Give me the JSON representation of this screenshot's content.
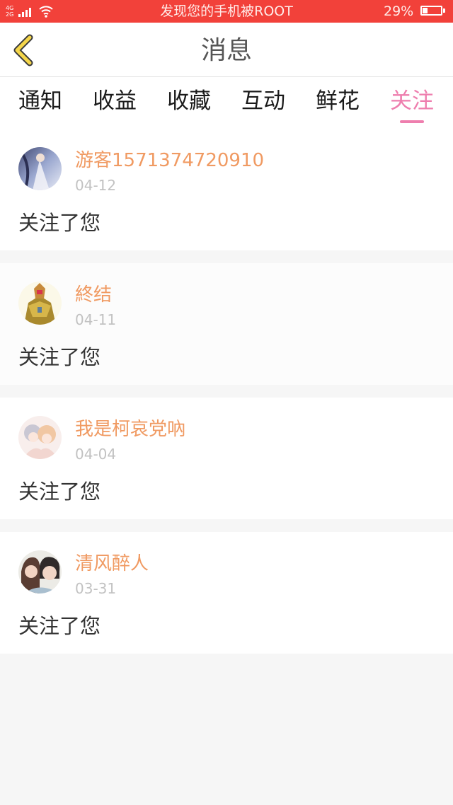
{
  "status_bar": {
    "network_top": "4G",
    "network_bottom": "2G",
    "title": "发现您的手机被ROOT",
    "battery": "29%",
    "battery_level": 0.29,
    "accent": "#f2413a"
  },
  "header": {
    "title": "消息",
    "back_icon": "chevron-left-icon",
    "back_icon_color": "#f5d64a"
  },
  "tabs": [
    {
      "label": "通知",
      "active": false
    },
    {
      "label": "收益",
      "active": false
    },
    {
      "label": "收藏",
      "active": false
    },
    {
      "label": "互动",
      "active": false
    },
    {
      "label": "鲜花",
      "active": false
    },
    {
      "label": "关注",
      "active": true
    }
  ],
  "colors": {
    "active_tab": "#ee7eae",
    "user_name": "#f09a62",
    "date": "#c2c2c2"
  },
  "notifications": [
    {
      "user": "游客1571374720910",
      "date": "04-12",
      "message": "关注了您",
      "avatar": "avatar-image"
    },
    {
      "user": "終结",
      "date": "04-11",
      "message": "关注了您",
      "avatar": "avatar-image"
    },
    {
      "user": "我是柯哀党吶",
      "date": "04-04",
      "message": "关注了您",
      "avatar": "avatar-image"
    },
    {
      "user": "清风醉人",
      "date": "03-31",
      "message": "关注了您",
      "avatar": "avatar-image"
    }
  ]
}
